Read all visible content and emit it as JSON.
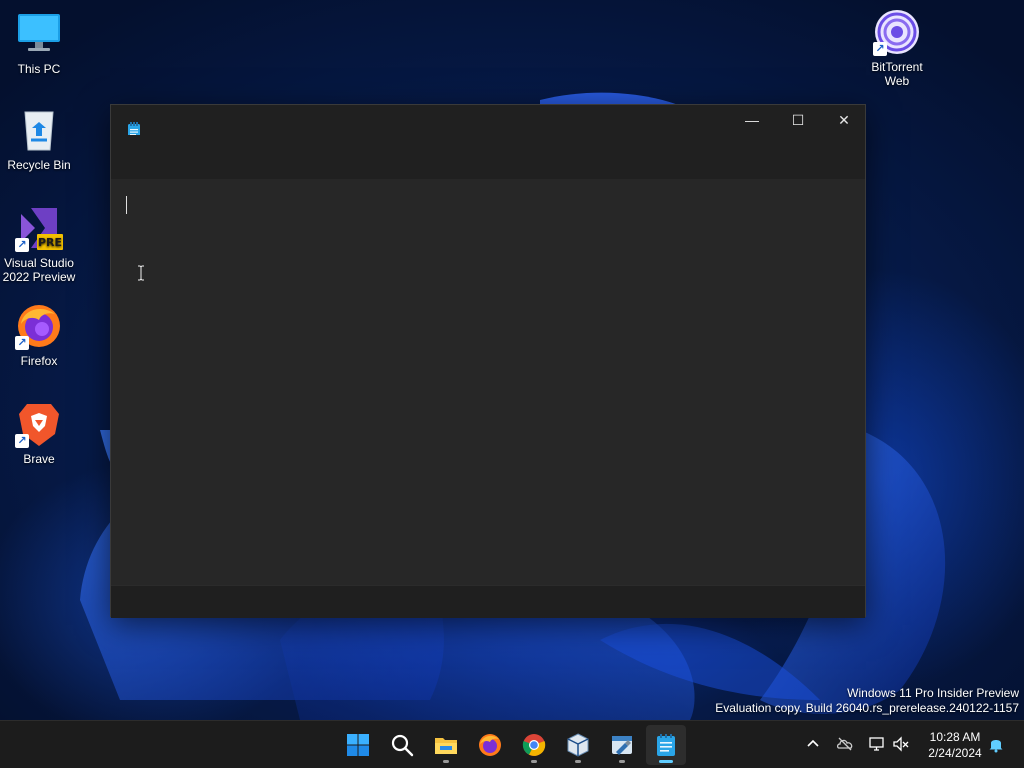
{
  "desktop": {
    "icons": [
      {
        "label": "This PC",
        "icon": "monitor-icon"
      },
      {
        "label": "Recycle Bin",
        "icon": "recycle-bin-icon"
      },
      {
        "label": "Visual Studio 2022 Preview",
        "icon": "visual-studio-icon",
        "badge": "PRE"
      },
      {
        "label": "Firefox",
        "icon": "firefox-icon"
      },
      {
        "label": "Brave",
        "icon": "brave-icon"
      },
      {
        "label": "BitTorrent Web",
        "icon": "bittorrent-icon"
      }
    ]
  },
  "window": {
    "app": "notepad",
    "controls": {
      "minimize": "—",
      "maximize": "☐",
      "close": "✕"
    }
  },
  "watermark": {
    "line1": "Windows 11 Pro Insider Preview",
    "line2": "Evaluation copy. Build 26040.rs_prerelease.240122-1157"
  },
  "taskbar": {
    "items": [
      "start-icon",
      "search-icon",
      "file-explorer-icon",
      "firefox-icon",
      "chrome-icon",
      "virtualbox-icon",
      "tool-icon",
      "notepad-icon"
    ],
    "active": "notepad-icon"
  },
  "clock": {
    "time": "10:28 AM",
    "date": "2/24/2024"
  },
  "colors": {
    "accent": "#60cdff",
    "window_bg": "#202020",
    "editor_bg": "#272727",
    "taskbar_bg": "#1c1c1c"
  }
}
